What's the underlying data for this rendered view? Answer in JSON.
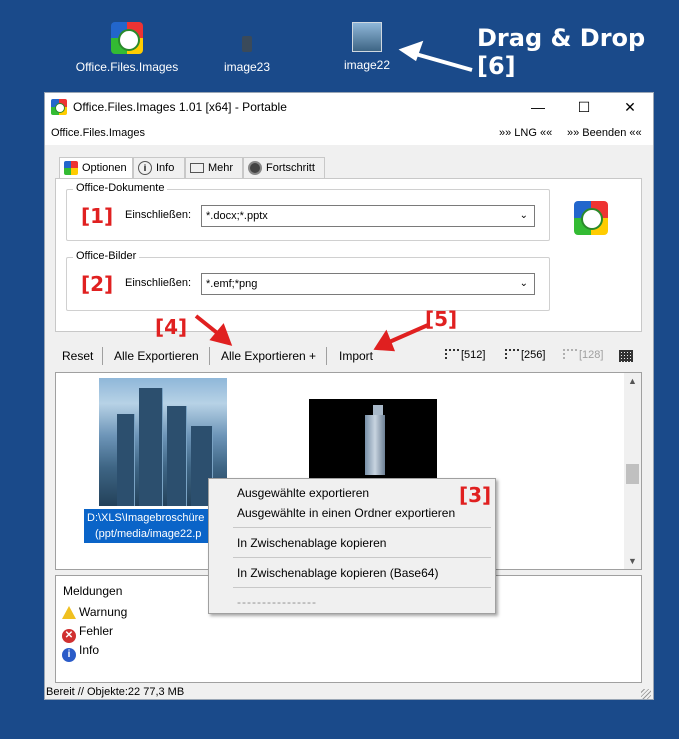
{
  "desktop": {
    "icons": [
      {
        "label": "Office.Files.Images",
        "icon": "app-icon"
      },
      {
        "label": "image23",
        "icon": "image-file-icon"
      },
      {
        "label": "image22",
        "icon": "image-file-icon"
      }
    ],
    "drag_drop_label": "Drag & Drop",
    "drag_drop_number": "[6]"
  },
  "window": {
    "title": "Office.Files.Images 1.01 [x64] - Portable",
    "controls": {
      "minimize": "—",
      "maximize": "☐",
      "close": "✕"
    },
    "menu": {
      "app_name": "Office.Files.Images",
      "lng": "»» LNG ««",
      "exit": "»» Beenden ««"
    }
  },
  "tabs": [
    {
      "label": "Optionen",
      "icon": "gear-icon",
      "active": true
    },
    {
      "label": "Info",
      "icon": "info-icon",
      "active": false
    },
    {
      "label": "Mehr",
      "icon": "ruler-icon",
      "active": false
    },
    {
      "label": "Fortschritt",
      "icon": "progress-icon",
      "active": false
    }
  ],
  "options": {
    "docs_group_title": "Office-Dokumente",
    "docs_annotation": "[1]",
    "docs_include_label": "Einschließen:",
    "docs_include_value": "*.docx;*.pptx",
    "images_group_title": "Office-Bilder",
    "images_annotation": "[2]",
    "images_include_label": "Einschließen:",
    "images_include_value": "*.emf;*png"
  },
  "toolbar": {
    "reset": "Reset",
    "export_all": "Alle Exportieren",
    "export_all_plus": "Alle Exportieren +",
    "import": "Import",
    "size_512": "[512]",
    "size_256": "[256]",
    "size_128": "[128]",
    "annotation_4": "[4]",
    "annotation_5": "[5]"
  },
  "listview": {
    "selected_caption_line1": "D:\\XLS\\Imagebroschüre",
    "selected_caption_line2": "(ppt/media/image22.p"
  },
  "context_menu": {
    "annotation": "[3]",
    "items": [
      "Ausgewählte exportieren",
      "Ausgewählte in einen Ordner exportieren",
      "In Zwischenablage kopieren",
      "In Zwischenablage kopieren (Base64)",
      "----------------"
    ]
  },
  "messages": {
    "title": "Meldungen",
    "warning": "Warnung",
    "error": "Fehler",
    "info": "Info"
  },
  "status": {
    "text": "Bereit // Objekte:22 77,3 MB"
  },
  "colors": {
    "desktop": "#1a4a8a",
    "annotation": "#e02020",
    "selection": "#0a64c8"
  }
}
